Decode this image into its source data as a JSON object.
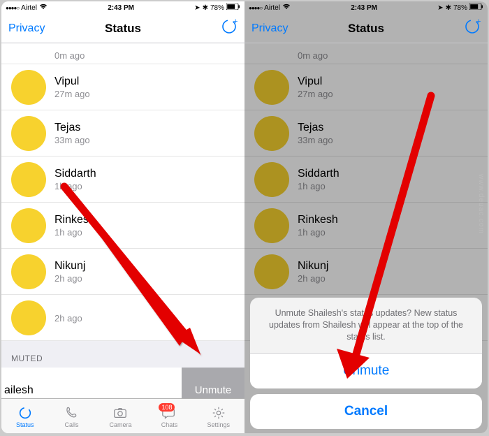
{
  "statusbar": {
    "carrier": "Airtel",
    "time": "2:43 PM",
    "battery": "78%"
  },
  "nav": {
    "back": "Privacy",
    "title": "Status"
  },
  "list_partial_time": "0m ago",
  "contacts": [
    {
      "name": "Vipul",
      "time": "27m ago"
    },
    {
      "name": "Tejas",
      "time": "33m ago"
    },
    {
      "name": "Siddarth",
      "time": "1h ago"
    },
    {
      "name": "Rinkesh",
      "time": "1h ago"
    },
    {
      "name": "Nikunj",
      "time": "2h ago"
    },
    {
      "name": "",
      "time": "2h ago"
    }
  ],
  "muted_header": "MUTED",
  "swiped_name": "ailesh",
  "unmute_label": "Unmute",
  "tabs": {
    "status": "Status",
    "calls": "Calls",
    "camera": "Camera",
    "chats": "Chats",
    "settings": "Settings",
    "chats_badge": "108"
  },
  "sheet": {
    "message": "Unmute Shailesh's status updates? New status updates from Shailesh will appear at the top of the status list.",
    "unmute": "Unmute",
    "cancel": "Cancel"
  },
  "watermark": "www.deuac.com"
}
